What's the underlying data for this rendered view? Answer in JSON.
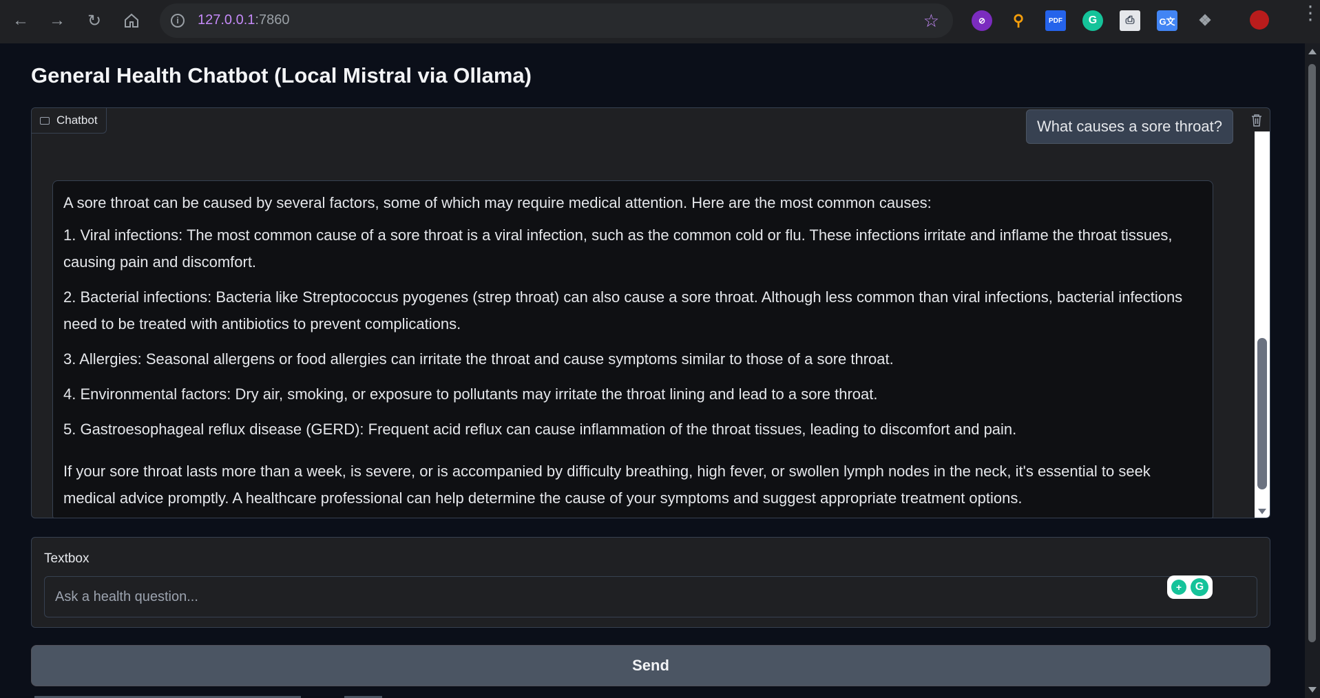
{
  "browser": {
    "url_host": "127.0.0.1",
    "url_port": ":7860"
  },
  "app": {
    "title": "General Health Chatbot (Local Mistral via Ollama)"
  },
  "chatbot": {
    "label": "Chatbot",
    "user_message": "What causes a sore throat?",
    "bot_response": {
      "intro": "A sore throat can be caused by several factors, some of which may require medical attention. Here are the most common causes:",
      "items": [
        "1. Viral infections: The most common cause of a sore throat is a viral infection, such as the common cold or flu. These infections irritate and inflame the throat tissues, causing pain and discomfort.",
        "2. Bacterial infections: Bacteria like Streptococcus pyogenes (strep throat) can also cause a sore throat. Although less common than viral infections, bacterial infections need to be treated with antibiotics to prevent complications.",
        "3. Allergies: Seasonal allergens or food allergies can irritate the throat and cause symptoms similar to those of a sore throat.",
        "4. Environmental factors: Dry air, smoking, or exposure to pollutants may irritate the throat lining and lead to a sore throat.",
        "5. Gastroesophageal reflux disease (GERD): Frequent acid reflux can cause inflammation of the throat tissues, leading to discomfort and pain."
      ],
      "outro": "If your sore throat lasts more than a week, is severe, or is accompanied by difficulty breathing, high fever, or swollen lymph nodes in the neck, it's essential to seek medical advice promptly. A healthcare professional can help determine the cause of your symptoms and suggest appropriate treatment options."
    }
  },
  "textbox": {
    "label": "Textbox",
    "placeholder": "Ask a health question...",
    "value": ""
  },
  "send_button": {
    "label": "Send"
  },
  "extensions": {
    "pdf_label": "PDF"
  },
  "colors": {
    "background": "#0b0f19",
    "panel": "#1f2023",
    "border": "#374151",
    "send_button": "#4b5563",
    "url_accent": "#c58af9"
  }
}
